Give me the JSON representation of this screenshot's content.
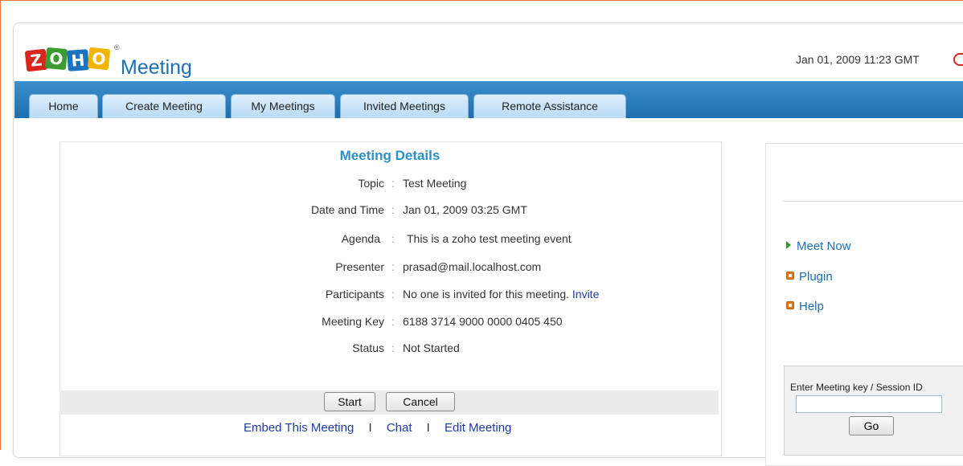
{
  "header": {
    "logo_letters": [
      "Z",
      "O",
      "H",
      "O"
    ],
    "app_name": "Meeting",
    "datetime": "Jan 01, 2009 11:23 GMT",
    "colors": {
      "brand_blue": "#1c6fb5",
      "nav_blue": "#2a7fbf",
      "z": "#d7261b",
      "o1": "#3d9c2f",
      "h": "#1b73c0",
      "o2": "#f2b400"
    }
  },
  "nav": {
    "tabs": [
      {
        "label": "Home"
      },
      {
        "label": "Create Meeting"
      },
      {
        "label": "My Meetings"
      },
      {
        "label": "Invited Meetings"
      },
      {
        "label": "Remote Assistance"
      }
    ]
  },
  "details": {
    "title": "Meeting Details",
    "separator": ":",
    "fields": [
      {
        "label": "Topic",
        "value": "Test Meeting"
      },
      {
        "label": "Date and Time",
        "value": "Jan 01, 2009 03:25 GMT"
      },
      {
        "label": "Agenda",
        "value": "This is a zoho test meeting event"
      },
      {
        "label": "Presenter",
        "value": "prasad@mail.localhost.com"
      },
      {
        "label": "Participants",
        "value": "No one is invited for this meeting.",
        "link": "Invite"
      },
      {
        "label": "Meeting Key",
        "value": "6188 3714 9000 0000 0405 450"
      },
      {
        "label": "Status",
        "value": "Not Started"
      }
    ],
    "buttons": {
      "start": "Start",
      "cancel": "Cancel"
    },
    "links": {
      "embed": "Embed This Meeting",
      "chat": "Chat",
      "edit": "Edit Meeting",
      "divider": "I"
    }
  },
  "sidebar": {
    "items": [
      {
        "label": "Meet Now",
        "icon": "play-arrow-icon"
      },
      {
        "label": "Plugin",
        "icon": "orange-bullet-icon"
      },
      {
        "label": "Help",
        "icon": "orange-bullet-icon"
      }
    ],
    "join": {
      "label": "Enter Meeting key / Session ID",
      "input_value": "",
      "go": "Go"
    }
  }
}
